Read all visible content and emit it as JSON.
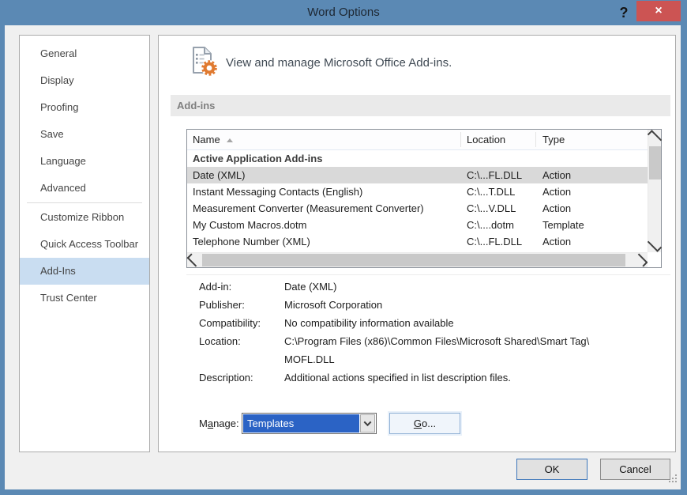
{
  "window": {
    "title": "Word Options"
  },
  "titlebar": {
    "help": "?",
    "close": "×"
  },
  "sidebar": {
    "items": [
      {
        "label": "General"
      },
      {
        "label": "Display"
      },
      {
        "label": "Proofing"
      },
      {
        "label": "Save"
      },
      {
        "label": "Language"
      },
      {
        "label": "Advanced"
      },
      {
        "label": "Customize Ribbon"
      },
      {
        "label": "Quick Access Toolbar"
      },
      {
        "label": "Add-Ins"
      },
      {
        "label": "Trust Center"
      }
    ],
    "selected": "Add-Ins"
  },
  "content": {
    "header": "View and manage Microsoft Office Add-ins.",
    "section_title": "Add-ins",
    "table": {
      "columns": [
        {
          "label": "Name",
          "sorted": "ascending"
        },
        {
          "label": "Location"
        },
        {
          "label": "Type"
        }
      ],
      "group_header": "Active Application Add-ins",
      "rows": [
        {
          "name": "Date (XML)",
          "location": "C:\\...FL.DLL",
          "type": "Action",
          "selected": true
        },
        {
          "name": "Instant Messaging Contacts (English)",
          "location": "C:\\...T.DLL",
          "type": "Action",
          "selected": false
        },
        {
          "name": "Measurement Converter (Measurement Converter)",
          "location": "C:\\...V.DLL",
          "type": "Action",
          "selected": false
        },
        {
          "name": "My Custom Macros.dotm",
          "location": "C:\\....dotm",
          "type": "Template",
          "selected": false
        },
        {
          "name": "Telephone Number (XML)",
          "location": "C:\\...FL.DLL",
          "type": "Action",
          "selected": false
        }
      ]
    },
    "details": {
      "rows": [
        {
          "label": "Add-in:",
          "value": "Date (XML)"
        },
        {
          "label": "Publisher:",
          "value": "Microsoft Corporation"
        },
        {
          "label": "Compatibility:",
          "value": "No compatibility information available"
        },
        {
          "label": "Location:",
          "value": "C:\\Program Files (x86)\\Common Files\\Microsoft Shared\\Smart Tag\\\nMOFL.DLL"
        },
        {
          "label": "Description:",
          "value": "Additional actions specified in list description files."
        }
      ]
    },
    "manage": {
      "label_parts": {
        "pre": "M",
        "accel": "a",
        "post": "nage:"
      },
      "value": "Templates",
      "go_parts": {
        "accel": "G",
        "post": "o..."
      }
    }
  },
  "footer": {
    "ok": "OK",
    "cancel": "Cancel"
  },
  "colors": {
    "titlebar": "#5b89b4",
    "close_button": "#cc5453",
    "sidebar_highlight": "#c9ddf1",
    "selected_row": "#d9d9d9",
    "selection_blue": "#2b63c5",
    "ok_border": "#3e77ba",
    "gear_orange": "#e07a30"
  }
}
